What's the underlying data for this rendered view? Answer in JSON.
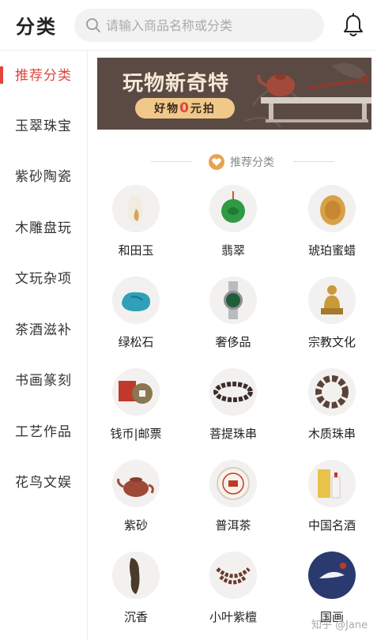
{
  "header": {
    "title": "分类",
    "search_placeholder": "请输入商品名称或分类"
  },
  "sidebar": {
    "items": [
      {
        "label": "推荐分类",
        "active": true
      },
      {
        "label": "玉翠珠宝",
        "active": false
      },
      {
        "label": "紫砂陶瓷",
        "active": false
      },
      {
        "label": "木雕盘玩",
        "active": false
      },
      {
        "label": "文玩杂项",
        "active": false
      },
      {
        "label": "茶酒滋补",
        "active": false
      },
      {
        "label": "书画篆刻",
        "active": false
      },
      {
        "label": "工艺作品",
        "active": false
      },
      {
        "label": "花鸟文娱",
        "active": false
      }
    ]
  },
  "banner": {
    "title": "玩物新奇特",
    "pill_prefix": "好物",
    "pill_num": "0",
    "pill_suffix": "元拍"
  },
  "section": {
    "label": "推荐分类"
  },
  "categories": [
    {
      "label": "和田玉",
      "icon": "hetian-jade-icon"
    },
    {
      "label": "翡翠",
      "icon": "jadeite-icon"
    },
    {
      "label": "琥珀蜜蜡",
      "icon": "amber-icon"
    },
    {
      "label": "绿松石",
      "icon": "turquoise-icon"
    },
    {
      "label": "奢侈品",
      "icon": "watch-icon"
    },
    {
      "label": "宗教文化",
      "icon": "buddha-icon"
    },
    {
      "label": "钱币|邮票",
      "icon": "coin-stamp-icon"
    },
    {
      "label": "菩提珠串",
      "icon": "bodhi-beads-icon"
    },
    {
      "label": "木质珠串",
      "icon": "wood-beads-icon"
    },
    {
      "label": "紫砂",
      "icon": "teapot-icon"
    },
    {
      "label": "普洱茶",
      "icon": "puer-tea-icon"
    },
    {
      "label": "中国名酒",
      "icon": "liquor-icon"
    },
    {
      "label": "沉香",
      "icon": "agarwood-icon"
    },
    {
      "label": "小叶紫檀",
      "icon": "sandalwood-beads-icon"
    },
    {
      "label": "国画",
      "icon": "chinese-painting-icon"
    }
  ],
  "watermark": "知乎 @Jane",
  "colors": {
    "accent": "#e0463c",
    "banner_bg": "#5b4a44",
    "pill_bg": "#f0c88a"
  }
}
